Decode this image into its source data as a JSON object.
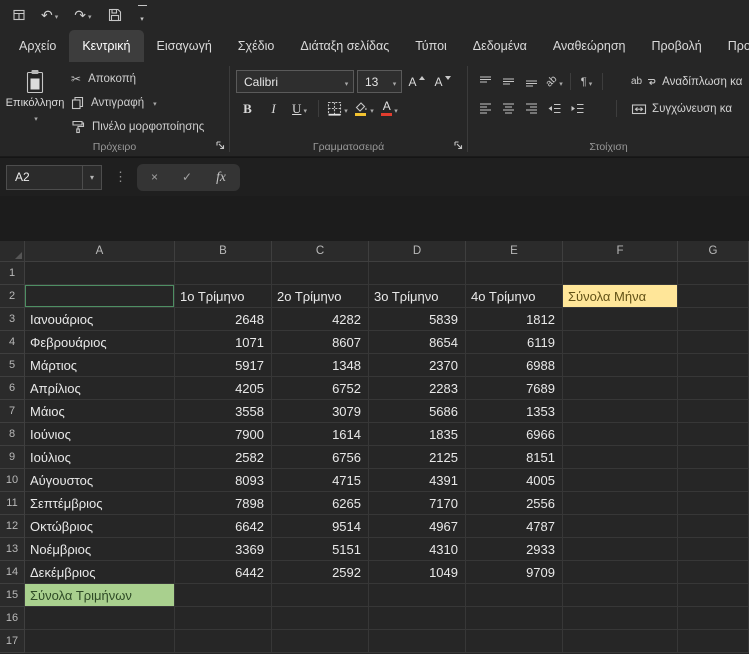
{
  "tabs": {
    "items": [
      "Αρχείο",
      "Κεντρική",
      "Εισαγωγή",
      "Σχέδιο",
      "Διάταξη σελίδας",
      "Τύποι",
      "Δεδομένα",
      "Αναθεώρηση",
      "Προβολή",
      "Προγ"
    ],
    "active_index": 1
  },
  "ribbon": {
    "paste": "Επικόλληση",
    "cut": "Αποκοπή",
    "copy": "Αντιγραφή",
    "format_painter": "Πινέλο μορφοποίησης",
    "clipboard_group": "Πρόχειρο",
    "font_name": "Calibri",
    "font_size": "13",
    "font_group": "Γραμματοσειρά",
    "wrap_text": "Αναδίπλωση κα",
    "merge_center": "Συγχώνευση κα",
    "alignment_group": "Στοίχιση"
  },
  "icons": {
    "undo": "↶",
    "redo": "↷",
    "cut": "✂",
    "bold": "B",
    "italic": "I",
    "underline": "U",
    "grow_font": "A",
    "shrink_font": "A",
    "font_color": "A",
    "orientation": "ab",
    "wrap_ab": "ab",
    "paragraph": "¶",
    "cancel": "×",
    "enter": "✓",
    "fx": "fx"
  },
  "formula": {
    "name_box": "A2"
  },
  "sheet": {
    "col_headers": [
      "A",
      "B",
      "C",
      "D",
      "E",
      "F",
      "G"
    ],
    "row_count": 17,
    "active_cell": "A2",
    "quarter_headers": [
      "1ο Τρίμηνο",
      "2ο Τρίμηνο",
      "3ο Τρίμηνο",
      "4ο Τρίμηνο"
    ],
    "monthly_totals_header": "Σύνολα Μήνα",
    "months": [
      "Ιανουάριος",
      "Φεβρουάριος",
      "Μάρτιος",
      "Απρίλιος",
      "Μάιος",
      "Ιούνιος",
      "Ιούλιος",
      "Αύγουστος",
      "Σεπτέμβριος",
      "Οκτώβριος",
      "Νοέμβριος",
      "Δεκέμβριος"
    ],
    "values": [
      [
        2648,
        4282,
        5839,
        1812
      ],
      [
        1071,
        8607,
        8654,
        6119
      ],
      [
        5917,
        1348,
        2370,
        6988
      ],
      [
        4205,
        6752,
        2283,
        7689
      ],
      [
        3558,
        3079,
        5686,
        1353
      ],
      [
        7900,
        1614,
        1835,
        6966
      ],
      [
        2582,
        6756,
        2125,
        8151
      ],
      [
        8093,
        4715,
        4391,
        4005
      ],
      [
        7898,
        6265,
        7170,
        2556
      ],
      [
        6642,
        9514,
        4967,
        4787
      ],
      [
        3369,
        5151,
        4310,
        2933
      ],
      [
        6442,
        2592,
        1049,
        9709
      ]
    ],
    "totals_label": "Σύνολα Τριμήνων"
  },
  "colors": {
    "totals_header_fill": "#ffe699",
    "totals_header_text": "#635217",
    "totals_row_fill": "#a9d08e",
    "totals_row_text": "#2e4a26",
    "selection_border": "#4e8f63",
    "fill_color_swatch": "#f2c230",
    "font_color_swatch": "#e23d2e"
  }
}
